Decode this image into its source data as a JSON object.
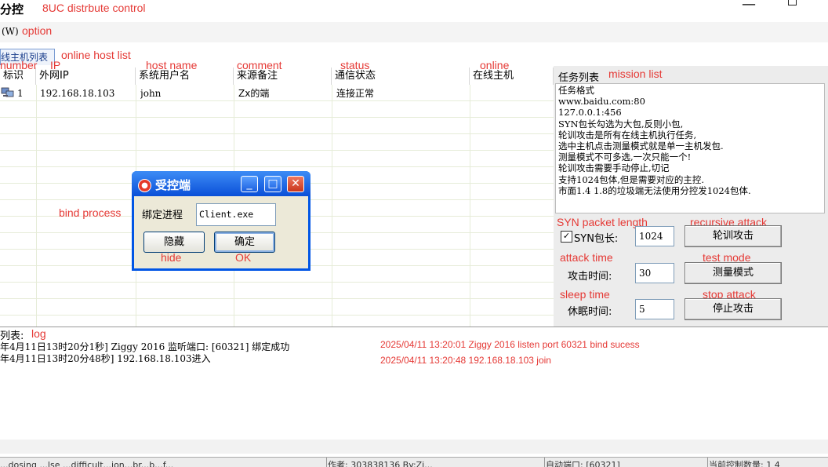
{
  "window": {
    "title": "分控",
    "title_annotation": "8UC distrbute control",
    "minimize_glyph": "—"
  },
  "menu": {
    "option_label": "(W)",
    "option_annotation": "option"
  },
  "tab": {
    "label": "线主机列表",
    "annotation": "online host list"
  },
  "host_table": {
    "column_annotations": [
      "number",
      "IP",
      "host name",
      "comment",
      "status",
      "online"
    ],
    "headers": [
      "标识",
      "外网IP",
      "系统用户名",
      "来源备注",
      "通信状态",
      "在线主机"
    ],
    "rows": [
      {
        "id": "1",
        "ip": "192.168.18.103",
        "user": "john",
        "note": "Zx的端",
        "status": "连接正常",
        "online": ""
      }
    ]
  },
  "mission": {
    "title": "任务列表",
    "annotation": "mission list",
    "lines": [
      "任务格式",
      "www.baidu.com:80",
      "127.0.0.1:456",
      "SYN包长勾选为大包,反则小包,",
      "轮训攻击是所有在线主机执行任务,",
      "选中主机点击测量模式就是单一主机发包.",
      "测量模式不可多选,一次只能一个!",
      "轮训攻击需要手动停止,切记",
      "支持1024包体,但是需要对应的主控.",
      "市面1.4 1.8的垃圾端无法使用分控发1024包体."
    ]
  },
  "controls": {
    "syn": {
      "label": "SYN包长:",
      "value": "1024",
      "checked": true,
      "check_glyph": "✓",
      "annotation": "SYN packet length"
    },
    "attack_time": {
      "label": "攻击时间:",
      "value": "30",
      "annotation": "attack time"
    },
    "sleep_time": {
      "label": "休眠时间:",
      "value": "5",
      "annotation": "sleep time"
    },
    "recursive_button": {
      "label": "轮训攻击",
      "annotation": "recursive attack"
    },
    "test_button": {
      "label": "测量模式",
      "annotation": "test mode"
    },
    "stop_button": {
      "label": "停止攻击",
      "annotation": "stop attack"
    }
  },
  "log": {
    "label": "列表:",
    "annotation": "log",
    "entries": [
      {
        "text": "年4月11日13时20分1秒]  Ziggy  2016  监听端口: [60321] 绑定成功",
        "translation": "2025/04/11 13:20:01 Ziggy 2016 listen port 60321 bind sucess"
      },
      {
        "text": "年4月11日13时20分48秒]  192.168.18.103进入",
        "translation": "2025/04/11 13:20:48 192.168.18.103 join"
      }
    ]
  },
  "statusbar": {
    "segments": [
      "...dosing ...lse ...difficult...ion...br...b...f...",
      "作者: 303838136  By:Zi...",
      "自动端口: [60321]",
      "当前控制数量: 1 4"
    ]
  },
  "dialog": {
    "title": "受控端",
    "bind_label": "绑定进程",
    "bind_annotation": "bind process",
    "process_value": "Client.exe",
    "hide_button": "隐藏",
    "hide_annotation": "hide",
    "ok_button": "确定",
    "ok_annotation": "OK",
    "min_glyph": "_",
    "max_glyph": "□",
    "close_glyph": "✕",
    "icon_glyph": "●"
  },
  "colors": {
    "annotation_red": "#e53935",
    "dialog_blue": "#0a4fd8",
    "close_red": "#c9361c"
  }
}
